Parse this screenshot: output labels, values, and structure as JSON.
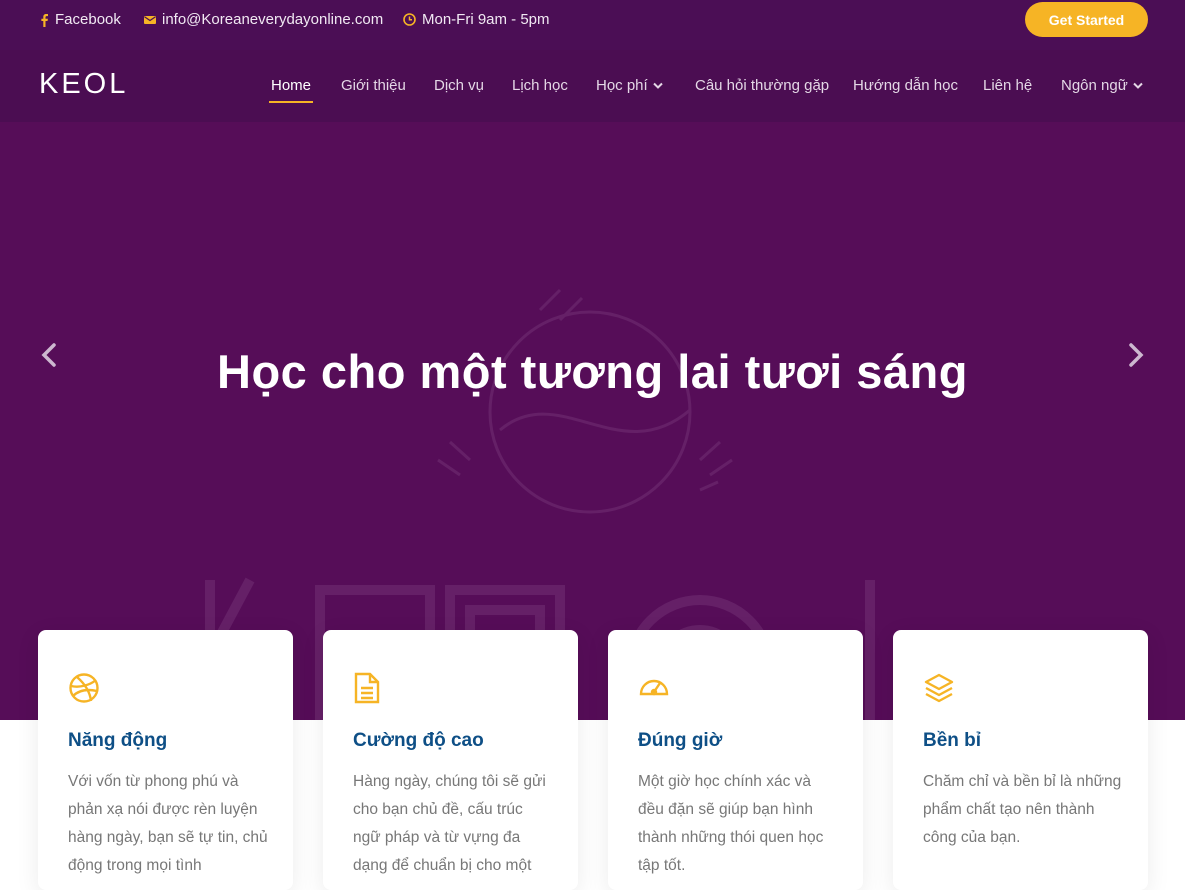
{
  "topbar": {
    "facebook": "Facebook",
    "email": "info@Koreaneverydayonline.com",
    "hours": "Mon-Fri 9am - 5pm",
    "cta": "Get Started"
  },
  "nav": {
    "logo": "KEOL",
    "items": [
      {
        "label": "Home",
        "active": true
      },
      {
        "label": "Giới thiệu"
      },
      {
        "label": "Dịch vụ"
      },
      {
        "label": "Lịch học"
      },
      {
        "label": "Học phí",
        "dropdown": true
      },
      {
        "label": "Câu hỏi thường gặp"
      },
      {
        "label": "Hướng dẫn học"
      },
      {
        "label": "Liên hệ"
      },
      {
        "label": "Ngôn ngữ",
        "dropdown": true
      }
    ]
  },
  "hero": {
    "title": "Học cho một tương lai tươi sáng"
  },
  "features": [
    {
      "icon": "dribbble-icon",
      "title": "Năng động",
      "text": "Với vốn từ phong phú và phản xạ nói được rèn luyện hàng ngày, bạn sẽ tự tin, chủ động trong mọi tình"
    },
    {
      "icon": "document-icon",
      "title": "Cường độ cao",
      "text": "Hàng ngày, chúng tôi sẽ gửi cho bạn chủ đề, cấu trúc ngữ pháp và từ vựng đa dạng để chuẩn bị cho một"
    },
    {
      "icon": "speedometer-icon",
      "title": "Đúng giờ",
      "text": "Một giờ học chính xác và đều đặn sẽ giúp bạn hình thành những thói quen học tập tốt."
    },
    {
      "icon": "layers-icon",
      "title": "Bền bỉ",
      "text": "Chăm chỉ và bền bỉ là những phẩm chất tạo nên thành công của bạn."
    }
  ],
  "colors": {
    "hero_bg": "#560d58",
    "topbar_bg": "#4b0e55",
    "accent": "#f6b425",
    "card_title": "#0e4f86"
  }
}
